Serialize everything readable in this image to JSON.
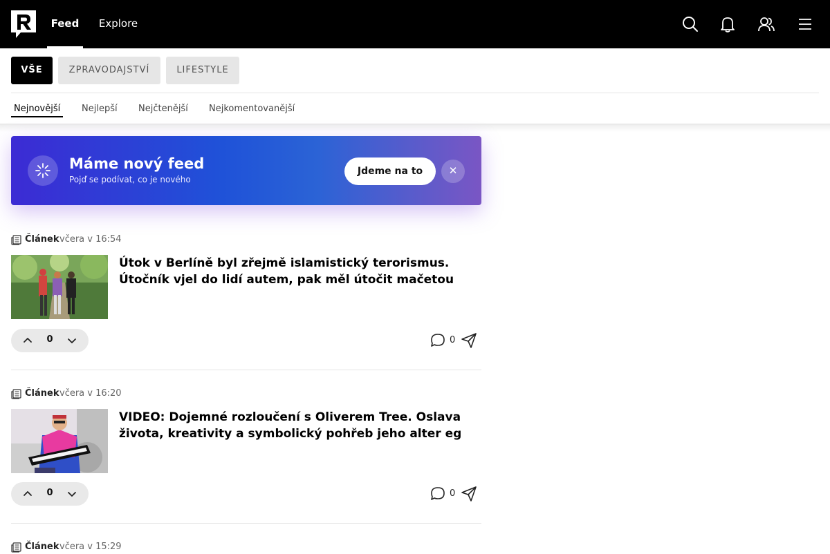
{
  "nav": {
    "tabs": [
      {
        "label": "Feed"
      },
      {
        "label": "Explore"
      }
    ],
    "icons": [
      "search-icon",
      "bell-icon",
      "users-icon",
      "menu-icon"
    ]
  },
  "categories": [
    {
      "label": "VŠE"
    },
    {
      "label": "ZPRAVODAJSTVÍ"
    },
    {
      "label": "LIFESTYLE"
    }
  ],
  "sort_tabs": [
    {
      "label": "Nejnovější"
    },
    {
      "label": "Nejlepší"
    },
    {
      "label": "Nejčtenější"
    },
    {
      "label": "Nejkomentovanější"
    }
  ],
  "banner": {
    "title": "Máme nový feed",
    "subtitle": "Pojď se podívat, co je nového",
    "button_label": "Jdeme na to",
    "close_label": "✕"
  },
  "items": [
    {
      "type": "Článek",
      "time": "včera v 16:54",
      "title": "Útok v Berlíně byl zřejmě islamistický terorismus. Útočník vjel do lidí autem, pak měl útočit mačetou",
      "votes": "0",
      "comments": "0"
    },
    {
      "type": "Článek",
      "time": "včera v 16:20",
      "title": "VIDEO: Dojemné rozloučení s Oliverem Tree. Oslava života, kreativity a symbolický pohřeb jeho alter eg",
      "votes": "0",
      "comments": "0"
    },
    {
      "type": "Článek",
      "time": "včera v 15:29"
    }
  ],
  "colors": {
    "topbar": "#000000",
    "banner_start": "#3c2bd4",
    "banner_end": "#7a56c4"
  }
}
